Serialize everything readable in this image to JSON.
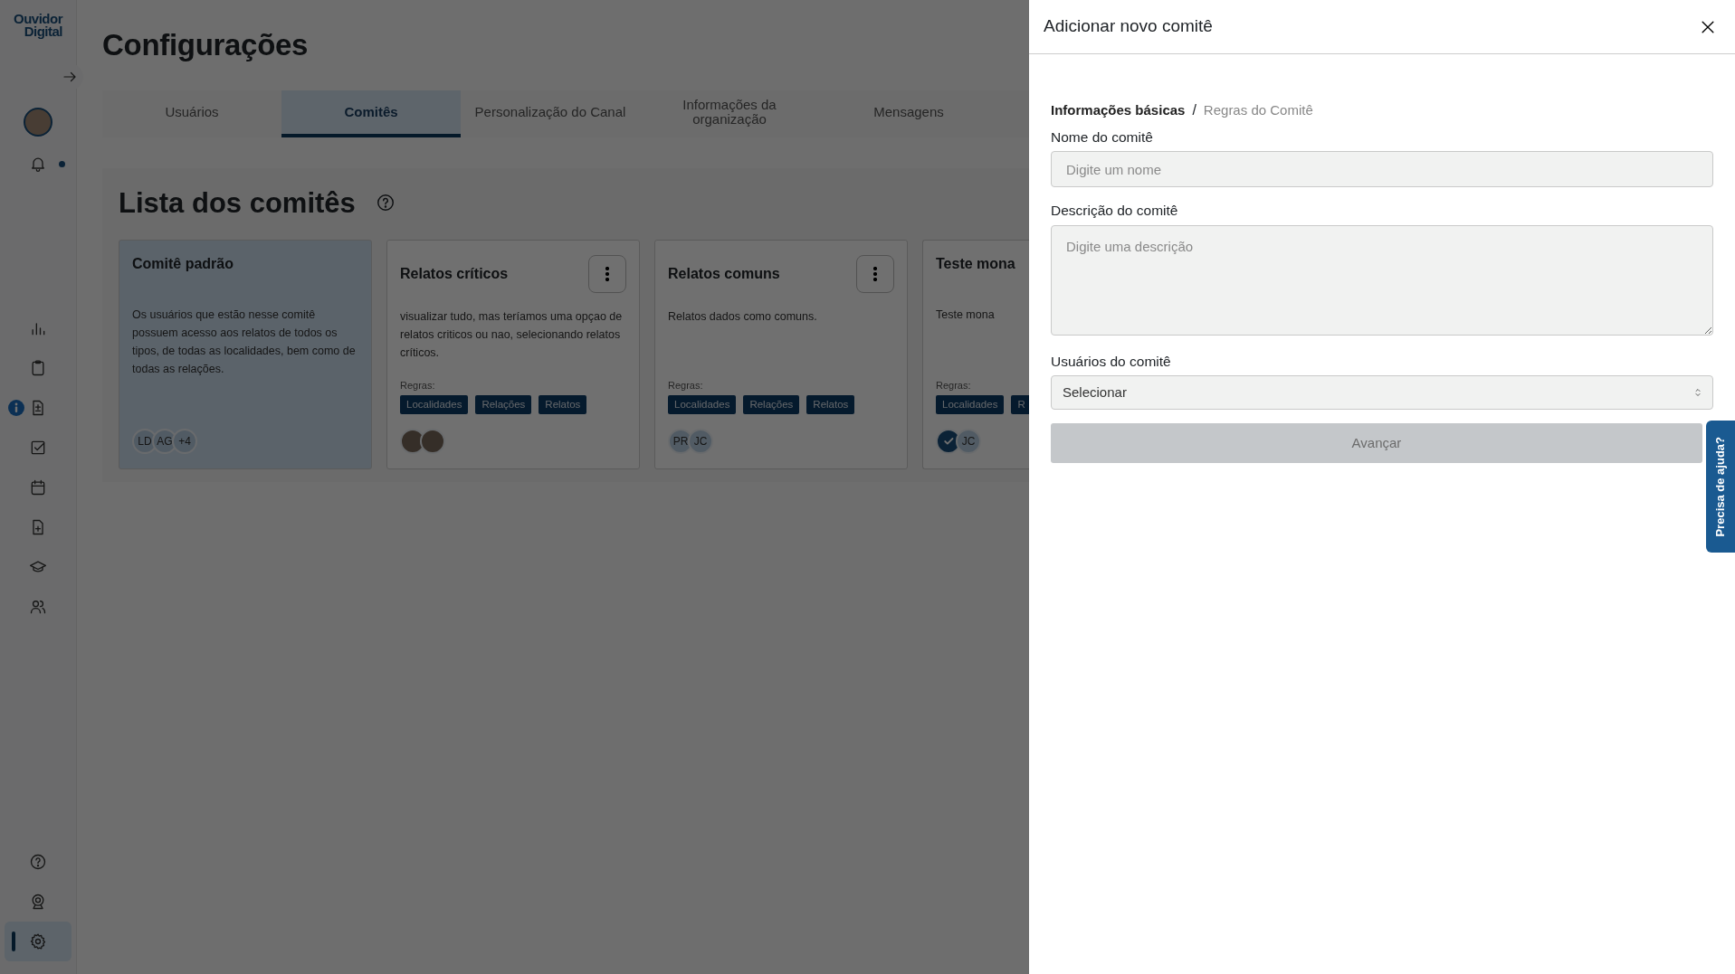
{
  "sidebar": {
    "logo_lines": [
      "Ouvidor",
      "Digital"
    ],
    "notifications_unread": true,
    "nav_items": [
      {
        "selected": false,
        "alert": false
      },
      {
        "selected": false,
        "alert": false
      },
      {
        "selected": false,
        "alert": true
      },
      {
        "selected": false,
        "alert": false
      },
      {
        "selected": false,
        "alert": false
      },
      {
        "selected": false,
        "alert": false
      },
      {
        "selected": false,
        "alert": false
      },
      {
        "selected": false,
        "alert": false
      }
    ],
    "bottom_items": [
      {
        "selected": false
      },
      {
        "selected": false
      },
      {
        "selected": true
      }
    ]
  },
  "page": {
    "title": "Configurações",
    "tabs": [
      {
        "label": "Usuários",
        "selected": false
      },
      {
        "label": "Comitês",
        "selected": true
      },
      {
        "label": "Personalização do Canal",
        "selected": false
      },
      {
        "label": "Informações da organização",
        "selected": false
      },
      {
        "label": "Mensagens",
        "selected": false
      }
    ],
    "section_title": "Lista dos comitês",
    "committees": [
      {
        "title": "Comitê padrão",
        "highlighted": true,
        "menu": false,
        "description": "Os usuários que estão nesse comitê possuem acesso aos relatos de todos os tipos, de todas as localidades, bem como de todas as relações.",
        "members": [
          {
            "kind": "initials",
            "text": "LD"
          },
          {
            "kind": "initials",
            "text": "AG"
          },
          {
            "kind": "initials",
            "text": "+4"
          }
        ]
      },
      {
        "title": "Relatos críticos",
        "highlighted": false,
        "menu": true,
        "description": "visualizar tudo, mas teríamos uma opçao de relatos criticos ou nao, selecionando relatos críticos.",
        "rules_label": "Regras:",
        "rules": [
          "Localidades",
          "Relações",
          "Relatos"
        ],
        "members": [
          {
            "kind": "photo"
          },
          {
            "kind": "photo"
          }
        ]
      },
      {
        "title": "Relatos comuns",
        "highlighted": false,
        "menu": true,
        "description": "Relatos dados como comuns.",
        "rules_label": "Regras:",
        "rules": [
          "Localidades",
          "Relações",
          "Relatos"
        ],
        "members": [
          {
            "kind": "initials",
            "text": "PR"
          },
          {
            "kind": "initials",
            "text": "JC"
          }
        ]
      },
      {
        "title": "Teste mona",
        "highlighted": false,
        "menu": false,
        "description": "Teste mona",
        "rules_label": "Regras:",
        "rules": [
          "Localidades",
          "R"
        ],
        "members": [
          {
            "kind": "badge"
          },
          {
            "kind": "initials",
            "text": "JC"
          }
        ]
      }
    ]
  },
  "drawer": {
    "title": "Adicionar novo comitê",
    "breadcrumb_separator": "/",
    "steps": [
      {
        "label": "Informações básicas",
        "selected": true
      },
      {
        "label": "Regras do Comitê",
        "selected": false
      }
    ],
    "name_field": {
      "label": "Nome do comitê",
      "placeholder": "Digite um nome"
    },
    "description_field": {
      "label": "Descrição do comitê",
      "placeholder": "Digite uma descrição"
    },
    "users_field": {
      "label": "Usuários do comitê",
      "value": "Selecionar"
    },
    "submit": {
      "label": "Avançar",
      "disabled": true
    }
  },
  "help_tab": {
    "label": "Precisa de ajuda?"
  }
}
